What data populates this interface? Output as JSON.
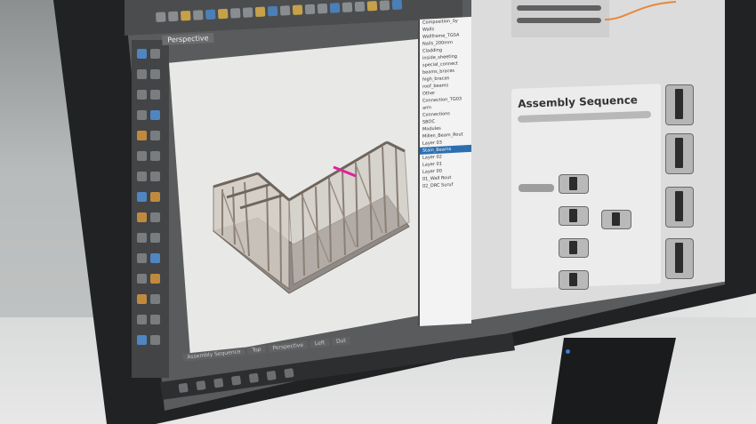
{
  "scene": "monitor-on-desk",
  "rhino": {
    "viewport_tab": "Perspective",
    "layers": [
      "Composition_Sy",
      "Walls",
      "Wallframe_TGSA",
      "Nails_200mm",
      "Cladding",
      "inside_sheeting",
      "special_connect",
      "beams_braces",
      "high_braces",
      "roof_beams",
      "Other",
      "Connection_TG03",
      "arm",
      "Connections",
      "SBOC",
      "Modules",
      "Millen_Beam_Rout",
      "Layer 03",
      "Stain_Beams",
      "Layer 02",
      "Layer 01",
      "Layer 00",
      "01_Wall Rout",
      "02_DRC Suruf"
    ],
    "selected_layer_index": 18,
    "bottom_tabs": [
      "Assembly Sequence",
      "Top",
      "Perspective",
      "Left",
      "Dut"
    ]
  },
  "grasshopper": {
    "group_title": "Assembly Sequence"
  },
  "colors": {
    "selection_edge": "#e0219b",
    "screen_bezel": "#202224",
    "led": "#2e7fd6"
  }
}
